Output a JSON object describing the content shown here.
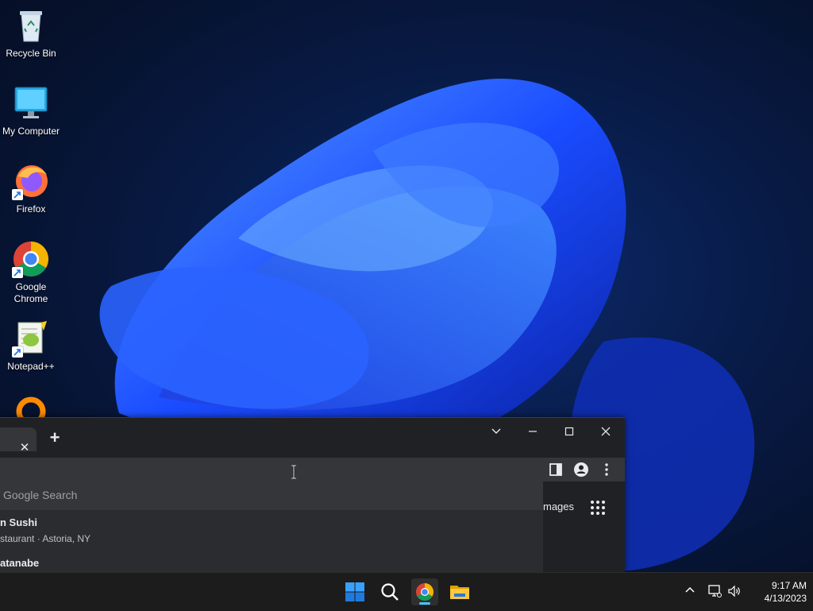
{
  "desktop": {
    "icons": [
      {
        "label": "Recycle Bin"
      },
      {
        "label": "My Computer"
      },
      {
        "label": "Firefox"
      },
      {
        "label": "Google Chrome"
      },
      {
        "label": "Notepad++"
      }
    ]
  },
  "chrome": {
    "tab_close": "✕",
    "new_tab": "+",
    "omnibox_placeholder": "Google Search",
    "suggestions": [
      {
        "title": "n Sushi",
        "subtitle": "staurant · Astoria, NY"
      },
      {
        "title": "atanabe"
      }
    ],
    "images_link": "mages"
  },
  "taskbar": {
    "time": "9:17 AM",
    "date": "4/13/2023"
  },
  "colors": {
    "accent": "#4cc2ff",
    "chrome_bg": "#202124",
    "omnibox_bg": "#35363a"
  }
}
